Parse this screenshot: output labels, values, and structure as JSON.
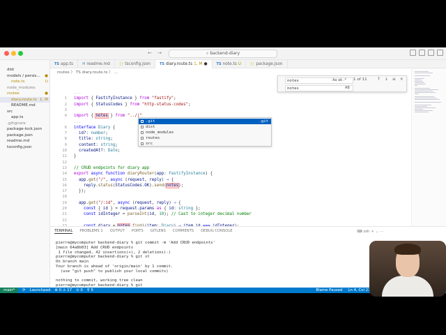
{
  "window": {
    "title": "backend-diary",
    "search_label": "backend-diary"
  },
  "sidebar": {
    "items": [
      {
        "label": "dist",
        "indent": 1,
        "color": "#333"
      },
      {
        "label": "models / persis...",
        "indent": 1,
        "color": "#333",
        "badge": "●"
      },
      {
        "label": "note.ts",
        "indent": 2,
        "color": "#b38b00",
        "badge": "U"
      },
      {
        "label": "node_modules",
        "indent": 1,
        "color": "#888"
      },
      {
        "label": "routes",
        "indent": 1,
        "color": "#b38b00",
        "badge": "●"
      },
      {
        "label": "diary.route.ts",
        "indent": 2,
        "color": "#b38b00",
        "badge": "1, M",
        "selected": true
      },
      {
        "label": "README.md",
        "indent": 2,
        "color": "#333"
      },
      {
        "label": "src",
        "indent": 1,
        "color": "#333"
      },
      {
        "label": "app.ts",
        "indent": 2,
        "color": "#333"
      },
      {
        "label": ".gitignore",
        "indent": 1,
        "color": "#888"
      },
      {
        "label": "package-lock.json",
        "indent": 1,
        "color": "#333"
      },
      {
        "label": "package.json",
        "indent": 1,
        "color": "#333"
      },
      {
        "label": "readme.md",
        "indent": 1,
        "color": "#333"
      },
      {
        "label": "tsconfig.json",
        "indent": 1,
        "color": "#333"
      }
    ]
  },
  "tabs": [
    {
      "label": "app.ts",
      "icon": "TS",
      "kind": "ts"
    },
    {
      "label": "readme.md",
      "icon": "M",
      "kind": "md"
    },
    {
      "label": "tsconfig.json",
      "icon": "{}",
      "kind": "js"
    },
    {
      "label": "diary.route.ts",
      "icon": "TS",
      "kind": "ts",
      "suffix": "1, M",
      "active": true,
      "dirty": "●"
    },
    {
      "label": "note.ts",
      "icon": "TS",
      "kind": "ts",
      "suffix": "U"
    },
    {
      "label": "package.json",
      "icon": "{}",
      "kind": "js"
    }
  ],
  "breadcrumb": "routes 〉 TS diary.route.ts 〉 ...",
  "find": {
    "find_value": "notes",
    "replace_value": "notes",
    "match_count": "1 of 11",
    "find_opts": "Aa  ab  .*",
    "replace_opts": "AB",
    "nav_buttons": "↑ ↓ ≡ ×"
  },
  "editor": {
    "lines": [
      {
        "n": "",
        "text": "...",
        "fold": true
      },
      {
        "n": "1",
        "html": "<span class='kw2'>import</span> { <span class='var'>FastifyInstance</span> } <span class='kw2'>from</span> <span class='str'>\"fastify\"</span>;"
      },
      {
        "n": "2",
        "html": "<span class='kw2'>import</span> { <span class='var'>StatusCodes</span> } <span class='kw2'>from</span> <span class='str'>\"http-status-codes\"</span>;"
      },
      {
        "n": "3",
        "html": ""
      },
      {
        "n": "4",
        "html": "<span class='kw2'>import</span> { <span class='var hl'>notes</span> } <span class='kw2'>from</span> <span class='str'>\"../|\"</span>"
      },
      {
        "n": "",
        "text": "...",
        "fold": true
      },
      {
        "n": "6",
        "html": "<span class='kw'>interface</span> <span class='ty'>Diary</span> {"
      },
      {
        "n": "7",
        "html": "  <span class='var'>id?</span>: <span class='ty'>number</span>;"
      },
      {
        "n": "8",
        "html": "  <span class='var'>title</span>: <span class='ty'>string</span>;"
      },
      {
        "n": "9",
        "html": "  <span class='var'>content</span>: <span class='ty'>string</span>;"
      },
      {
        "n": "10",
        "html": "  <span class='var'>createdAt?</span>: <span class='ty'>Date</span>;"
      },
      {
        "n": "11",
        "html": "}"
      },
      {
        "n": "12",
        "html": ""
      },
      {
        "n": "13",
        "html": "<span class='com'>// CRUD endpoints for diary app</span>"
      },
      {
        "n": "14",
        "html": "<span class='kw2'>export</span> <span class='kw'>async</span> <span class='kw'>function</span> <span class='fn'>diaryRouter</span>(<span class='var'>app</span>: <span class='ty'>FastifyInstance</span>) {"
      },
      {
        "n": "15",
        "html": "  <span class='var'>app</span>.<span class='fn'>get</span>(<span class='str'>\"/\"</span>, <span class='kw'>async</span> (<span class='var'>request</span>, <span class='var'>reply</span>) <span class='kw'>⇒</span> {"
      },
      {
        "n": "16",
        "html": "    <span class='var'>reply</span>.<span class='fn'>status</span>(<span class='var'>StatusCodes</span>.<span class='var'>OK</span>).<span class='fn'>send</span>(<span class='var hl'>notes</span>);"
      },
      {
        "n": "17",
        "html": "  });"
      },
      {
        "n": "18",
        "html": ""
      },
      {
        "n": "19",
        "html": "  <span class='var'>app</span>.<span class='fn'>get</span>(<span class='str'>\"/:id\"</span>, <span class='kw'>async</span> (<span class='var'>request</span>, <span class='var'>reply</span>) <span class='kw'>⇒</span> {"
      },
      {
        "n": "20",
        "html": "    <span class='kw'>const</span> { <span class='var'>id</span> } = <span class='var'>request</span>.<span class='var'>params</span> <span class='kw2'>as</span> { <span class='var'>id</span>: <span class='ty'>string</span> };"
      },
      {
        "n": "21",
        "html": "    <span class='kw'>const</span> <span class='var'>idInteger</span> = <span class='fn'>parseInt</span>(<span class='var'>id</span>, <span class='num'>10</span>); <span class='com'>// Cast to integer decimal number</span>"
      },
      {
        "n": "22",
        "html": ""
      },
      {
        "n": "23",
        "html": "    <span class='kw'>const</span> <span class='var'>diary</span> = <span class='var hl'>notes</span>.<span class='fn'>find</span>((<span class='var'>item</span>: <span class='ty'>Diary</span>) <span class='kw'>⇒</span> <span class='var'>item</span>.<span class='var'>id</span> <span class='kw'>===</span> <span class='var'>idInteger</span>);"
      },
      {
        "n": "24",
        "html": ""
      }
    ]
  },
  "suggest": {
    "items": [
      {
        "label": ".git",
        "detail": ".git",
        "selected": true
      },
      {
        "label": "dist"
      },
      {
        "label": "node_modules"
      },
      {
        "label": "routes"
      },
      {
        "label": "src"
      }
    ]
  },
  "panel": {
    "tabs": [
      "TERMINAL",
      "PROBLEMS 1",
      "OUTPUT",
      "PORTS",
      "GITLENS",
      "COMMENTS",
      "DEBUG CONSOLE"
    ],
    "right_label": "zsh",
    "terminal_lines": [
      "pierre@mycomputer backend-diary % git commit -m 'Add CRUD endpoints'",
      "[main 64a8b03] Add CRUD endpoints",
      " 1 file changed, 42 insertions(+), 2 deletions(-)",
      "pierre@mycomputer backend-diary % git st",
      "On branch main",
      "Your branch is ahead of 'origin/main' by 1 commit.",
      "  (use \"git push\" to publish your local commits)",
      "",
      "nothing to commit, working tree clean",
      "pierre@mycomputer backend-diary % git",
      "pierre@mycomputer backend-diary % ▮"
    ]
  },
  "statusbar": {
    "left": [
      "main*",
      "⟳",
      "Launchpad",
      "⊗ 0 ⚠ 17",
      "⊙ 0",
      "⚲ 5"
    ],
    "right": [
      "Blame Paused",
      "Ln 4, Col 27",
      "Spaces: 2",
      "UTF-8",
      "LF",
      "{} TypeS"
    ]
  },
  "colors": {
    "accent": "#007acc",
    "modified": "#b38b00",
    "selection": "#0060c0"
  }
}
